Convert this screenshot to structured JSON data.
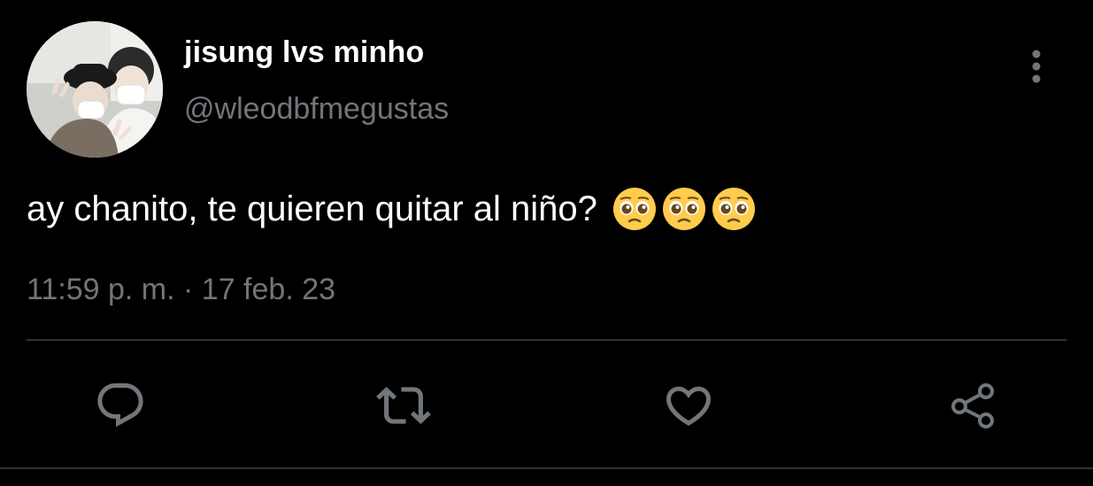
{
  "user": {
    "display_name": "jisung lvs minho",
    "handle": "@wleodbfmegustas",
    "avatar_icon": "profile-photo"
  },
  "tweet": {
    "text": "ay chanito, te quieren quitar al niño?",
    "emojis": [
      "pleading-face",
      "pleading-face",
      "pleading-face"
    ],
    "timestamp": "11:59 p. m. · 17 feb. 23"
  },
  "actions": [
    {
      "icon": "reply-icon"
    },
    {
      "icon": "retweet-icon"
    },
    {
      "icon": "like-icon"
    },
    {
      "icon": "share-icon"
    }
  ],
  "menu": {
    "icon": "more-vertical-icon"
  },
  "colors": {
    "background": "#000000",
    "primary_text": "#ffffff",
    "secondary_text": "#71767b",
    "divider": "#2f3336"
  }
}
